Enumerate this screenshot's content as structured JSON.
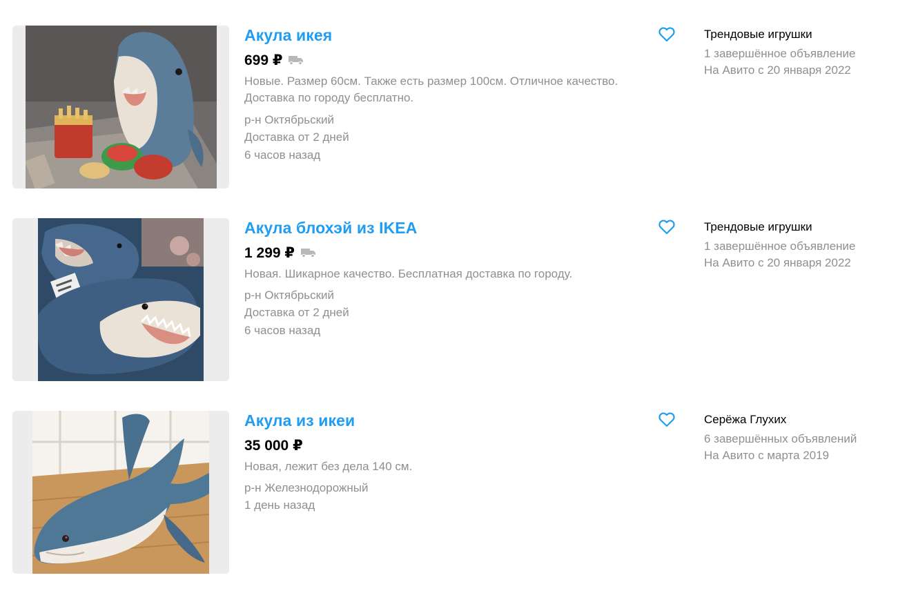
{
  "listings": [
    {
      "title": "Акула икея",
      "price": "699 ₽",
      "has_delivery_icon": true,
      "description": "Новые. Размер 60см. Также есть размер 100см. Отличное качество. Доставка по городу бесплатно.",
      "meta": [
        "р-н Октябрьский",
        "Доставка от 2 дней",
        "6 часов назад"
      ],
      "seller": {
        "name": "Трендовые игрушки",
        "completed": "1 завершённое объявление",
        "since": "На Авито с 20 января 2022"
      }
    },
    {
      "title": "Акула блохэй из IKEA",
      "price": "1 299 ₽",
      "has_delivery_icon": true,
      "description": "Новая. Шикарное качество. Бесплатная доставка по городу.",
      "meta": [
        "р-н Октябрьский",
        "Доставка от 2 дней",
        "6 часов назад"
      ],
      "seller": {
        "name": "Трендовые игрушки",
        "completed": "1 завершённое объявление",
        "since": "На Авито с 20 января 2022"
      }
    },
    {
      "title": "Акула из икеи",
      "price": "35 000 ₽",
      "has_delivery_icon": false,
      "description": "Новая, лежит без дела 140 см.",
      "meta": [
        "р-н Железнодорожный",
        "1 день назад"
      ],
      "seller": {
        "name": "Серёжа Глухих",
        "completed": "6 завершённых объявлений",
        "since": "На Авито с марта 2019"
      }
    }
  ],
  "icons": {
    "favorite": "heart-outline-icon",
    "delivery": "truck-icon"
  },
  "colors": {
    "title": "#1e9df2",
    "heart": "#1e9df2",
    "muted": "#8f8f8f",
    "truck": "#b8b8b8"
  }
}
